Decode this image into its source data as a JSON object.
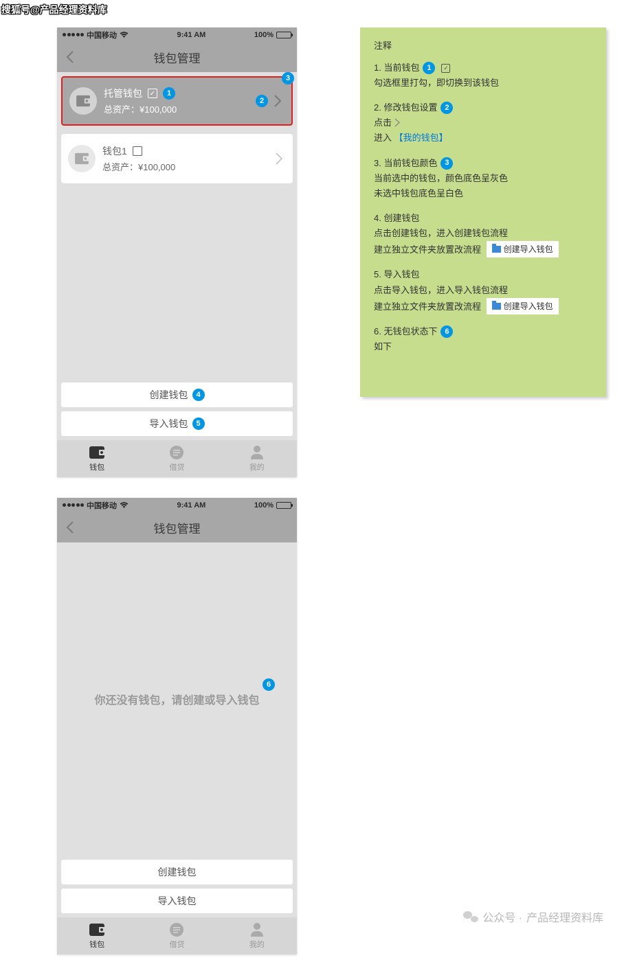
{
  "watermark_top": "搜狐号@产品经理资料库",
  "watermark_bottom_prefix": "公众号 · ",
  "watermark_bottom_name": "产品经理资料库",
  "status": {
    "carrier": "中国移动",
    "time": "9:41 AM",
    "battery": "100%"
  },
  "nav": {
    "title": "钱包管理"
  },
  "wallet1": {
    "name": "托管钱包",
    "assets_label": "总资产：",
    "assets_value": "¥100,000",
    "checked": "✓"
  },
  "wallet2": {
    "name": "钱包1",
    "assets_label": "总资产：",
    "assets_value": "¥100,000"
  },
  "buttons": {
    "create": "创建钱包",
    "import": "导入钱包"
  },
  "tabs": {
    "wallet": "钱包",
    "loan": "借贷",
    "me": "我的"
  },
  "empty_msg": "你还没有钱包，请创建或导入钱包",
  "badges": {
    "b1": "1",
    "b2": "2",
    "b3": "3",
    "b4": "4",
    "b5": "5",
    "b6": "6"
  },
  "annotations": {
    "title": "注释",
    "i1_head": "1. 当前钱包",
    "i1_body": "勾选框里打勾，即切换到该钱包",
    "i2_head": "2. 修改钱包设置",
    "i2_body1": "点击",
    "i2_body2": "进入",
    "i2_link": "【我的钱包】",
    "i3_head": "3. 当前钱包颜色",
    "i3_body1": "当前选中的钱包，颜色底色呈灰色",
    "i3_body2": "未选中钱包底色呈白色",
    "i4_head": "4. 创建钱包",
    "i4_body1": "点击创建钱包，进入创建钱包流程",
    "i4_body2": "建立独立文件夹放置改流程",
    "i5_head": "5. 导入钱包",
    "i5_body1": "点击导入钱包，进入导入钱包流程",
    "i5_body2": "建立独立文件夹放置改流程",
    "i6_head": "6. 无钱包状态下",
    "i6_body": "如下",
    "folder_label": "创建导入钱包"
  }
}
